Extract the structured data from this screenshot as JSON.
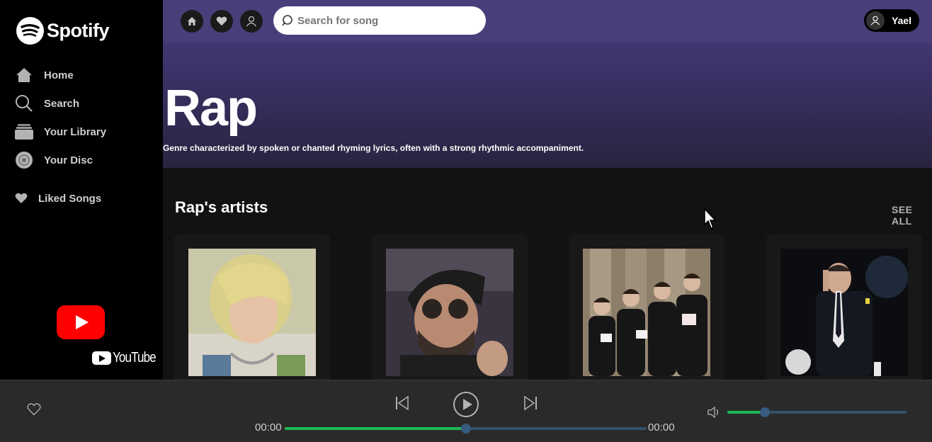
{
  "brand": {
    "name": "Spotify"
  },
  "sidebar": {
    "items": [
      {
        "label": "Home",
        "icon": "home-icon"
      },
      {
        "label": "Search",
        "icon": "search-icon"
      },
      {
        "label": "Your Library",
        "icon": "library-icon"
      },
      {
        "label": "Your Disc",
        "icon": "disc-icon"
      }
    ],
    "liked": {
      "label": "Liked Songs",
      "icon": "heart-icon"
    },
    "youtube_label": "YouTube"
  },
  "topbar": {
    "search_placeholder": "Search for song",
    "user_name": "Yael"
  },
  "genre": {
    "title": "Rap",
    "description": "Genre characterized by spoken or chanted rhyming lyrics, often with a strong rhythmic accompaniment."
  },
  "section": {
    "title": "Rap's artists",
    "see_all": "SEE ALL"
  },
  "player": {
    "time_current": "00:00",
    "time_total": "00:00",
    "progress": 0.5,
    "volume": 0.21
  },
  "colors": {
    "accent": "#1db954",
    "hero": "#4a3e7a",
    "sidebar": "#000000",
    "player": "#2a2a2a"
  }
}
